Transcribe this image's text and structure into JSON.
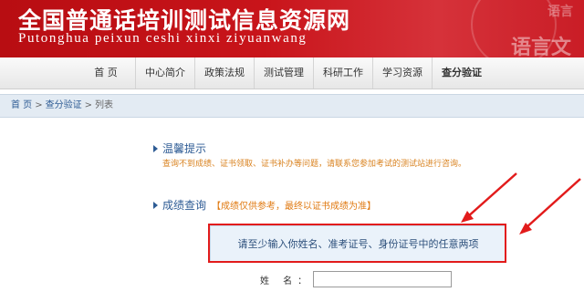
{
  "banner": {
    "title": "全国普通话培训测试信息资源网",
    "subtitle": "Putonghua peixun ceshi xinxi ziyuanwang",
    "deco_top": "语言",
    "deco_bottom": "语言文"
  },
  "nav": {
    "items": [
      {
        "label": "首 页"
      },
      {
        "label": "中心简介"
      },
      {
        "label": "政策法规"
      },
      {
        "label": "测试管理"
      },
      {
        "label": "科研工作"
      },
      {
        "label": "学习资源"
      },
      {
        "label": "查分验证"
      }
    ]
  },
  "breadcrumb": {
    "home": "首 页",
    "sep1": ">",
    "section": "查分验证",
    "sep2": ">",
    "current": "列表"
  },
  "warm_tips": {
    "title": "温馨提示",
    "text": "查询不到成绩、证书领取、证书补办等问题，请联系您参加考试的测试站进行咨询。"
  },
  "score_query": {
    "title": "成绩查询",
    "note": "【成绩仅供参考，最终以证书成绩为准】",
    "notice": "请至少输入你姓名、准考证号、身份证号中的任意两项",
    "name_label": "姓 名：",
    "name_value": ""
  },
  "colors": {
    "banner": "#c8141a",
    "link": "#2d5b94",
    "accent_orange": "#e07a12",
    "highlight_red": "#e21b1b"
  }
}
